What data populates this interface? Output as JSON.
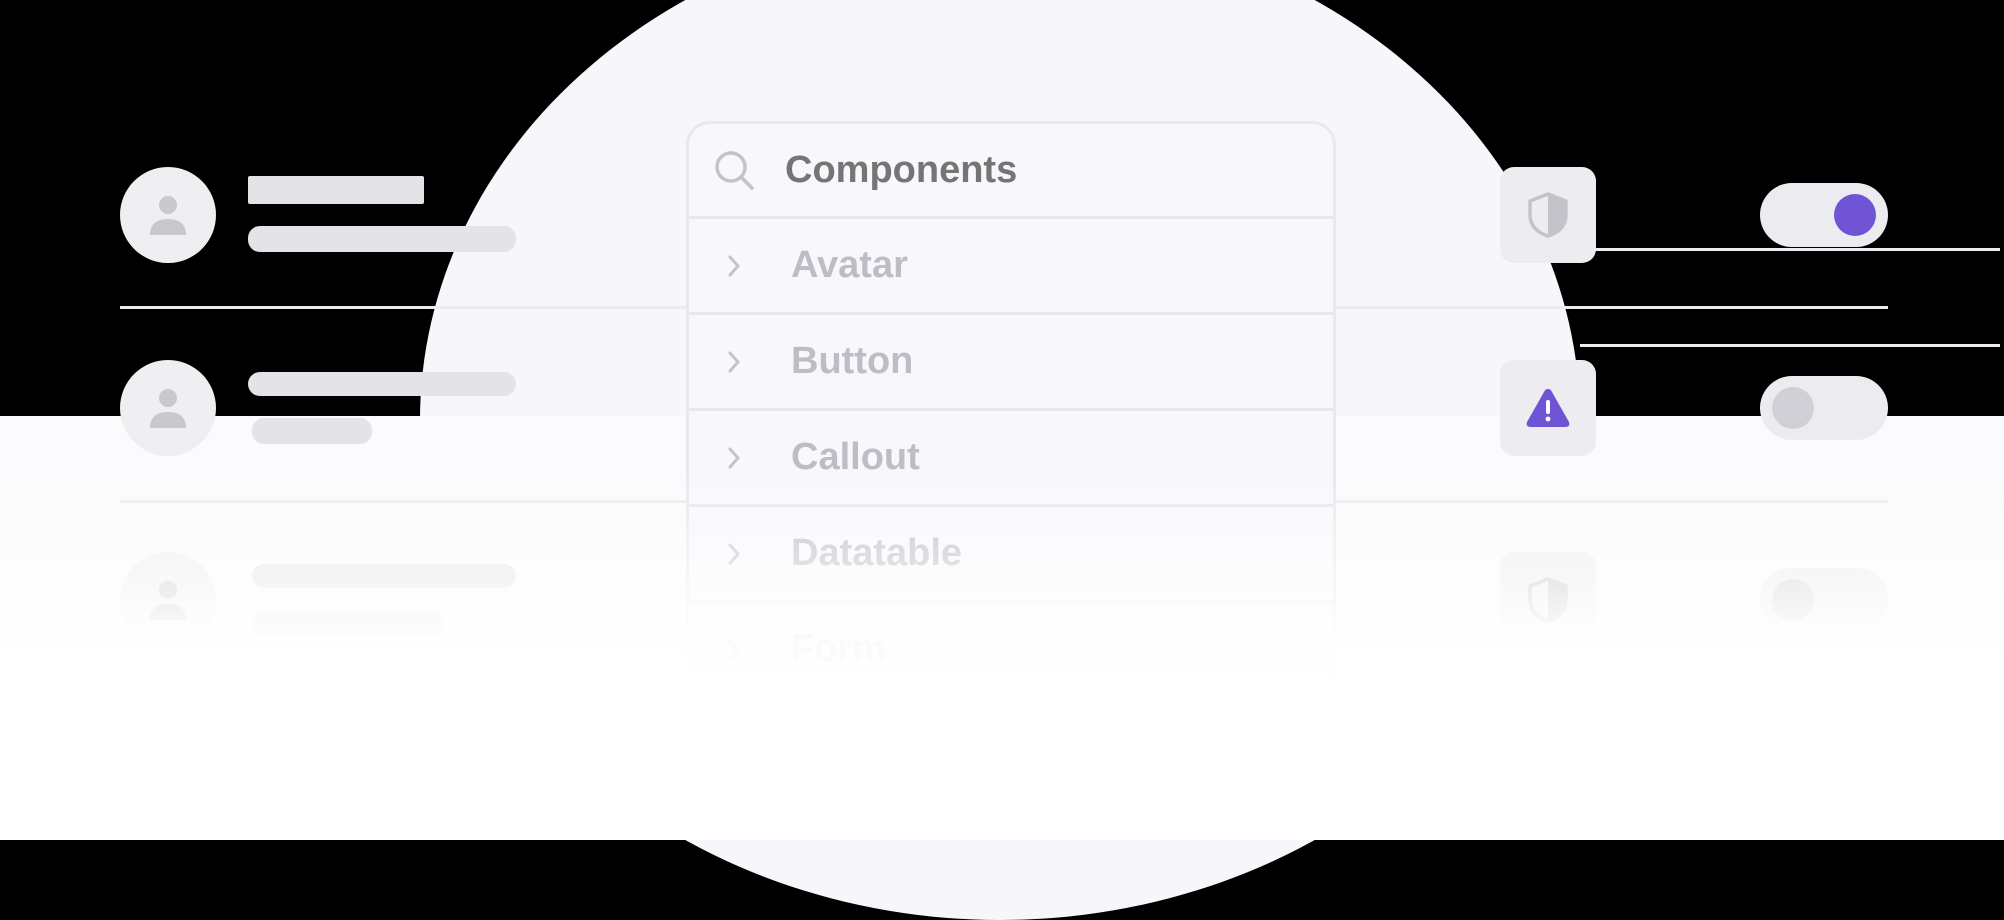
{
  "search": {
    "placeholder": "Components",
    "icon": "search-icon"
  },
  "components": [
    {
      "label": "Avatar",
      "icon": "chevron-right-icon"
    },
    {
      "label": "Button",
      "icon": "chevron-right-icon"
    },
    {
      "label": "Callout",
      "icon": "chevron-right-icon"
    },
    {
      "label": "Datatable",
      "icon": "chevron-right-icon"
    },
    {
      "label": "Form",
      "icon": "chevron-right-icon"
    }
  ],
  "colors": {
    "accent": "#6f55d6",
    "background": "#000000",
    "surface": "#f8f7fb",
    "border": "#e9e8ee",
    "muted_text": "#bebdc6",
    "placeholder": "#e4e4e8",
    "toggle_off_knob": "#d1d0d6"
  },
  "toggles": [
    {
      "state": "on"
    },
    {
      "state": "off"
    },
    {
      "state": "off"
    }
  ],
  "status_icons": [
    "shield-icon",
    "warning-triangle-icon",
    "shield-icon"
  ]
}
